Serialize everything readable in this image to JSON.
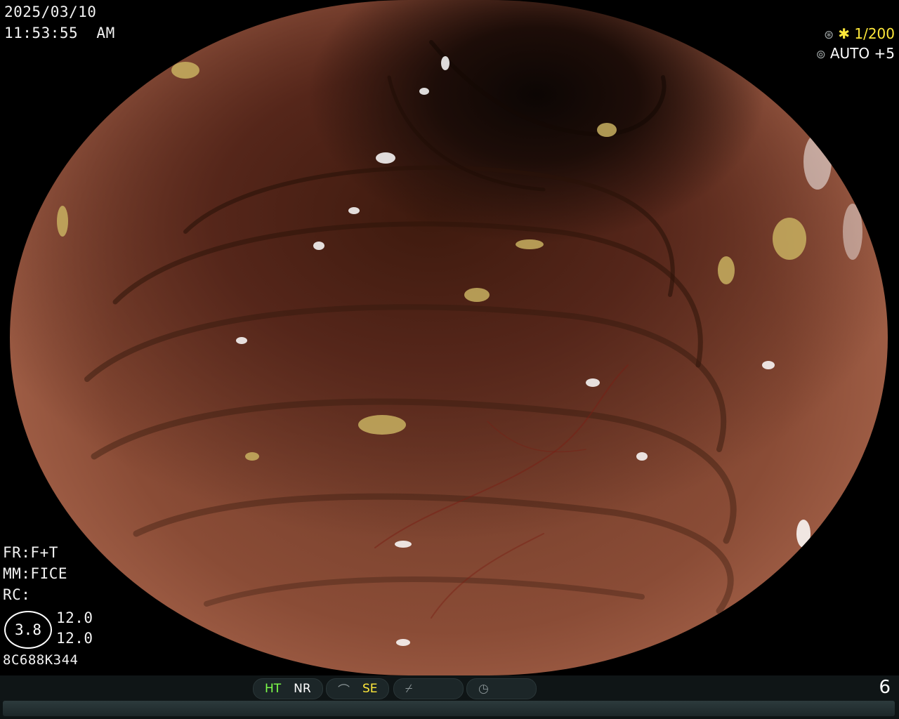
{
  "timestamp": {
    "date": "2025/03/10",
    "time": "11:53:55  AM"
  },
  "exposure": {
    "shutter_icon": "shutter-icon",
    "shutter": "✱ 1/200",
    "iris_icon": "iris-icon",
    "auto": "AUTO +5"
  },
  "settings": {
    "fr": "FR:F+T",
    "mm": "MM:FICE",
    "rc": "RC:",
    "zoom_circle": "3.8",
    "value_1": "12.0",
    "value_2": "12.0",
    "serial": "8C688K344"
  },
  "statusbar": {
    "ht": "HT",
    "nr": "NR",
    "se": "SE",
    "page_number": "6"
  },
  "colors": {
    "ht": "#7dff4a",
    "se": "#ffe83a",
    "shutter": "#ffe83a",
    "background": "#000000"
  }
}
